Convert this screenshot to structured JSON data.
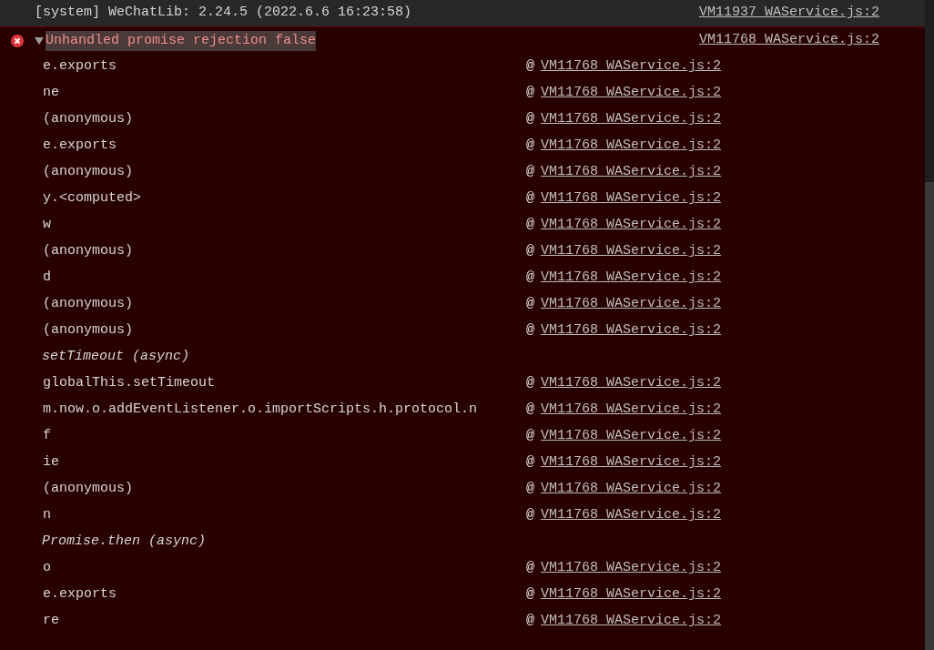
{
  "system_message": {
    "text": "[system] WeChatLib: 2.24.5 (2022.6.6 16:23:58)",
    "source": "VM11937 WAService.js:2"
  },
  "error": {
    "message": "Unhandled promise rejection false",
    "source": "VM11768 WAService.js:2",
    "expanded": true,
    "stack": [
      {
        "kind": "frame",
        "name": "e.exports",
        "at": "@",
        "source": "VM11768 WAService.js:2"
      },
      {
        "kind": "frame",
        "name": "ne",
        "at": "@",
        "source": "VM11768 WAService.js:2"
      },
      {
        "kind": "frame",
        "name": "(anonymous)",
        "at": "@",
        "source": "VM11768 WAService.js:2"
      },
      {
        "kind": "frame",
        "name": "e.exports",
        "at": "@",
        "source": "VM11768 WAService.js:2"
      },
      {
        "kind": "frame",
        "name": "(anonymous)",
        "at": "@",
        "source": "VM11768 WAService.js:2"
      },
      {
        "kind": "frame",
        "name": "y.<computed>",
        "at": "@",
        "source": "VM11768 WAService.js:2"
      },
      {
        "kind": "frame",
        "name": "w",
        "at": "@",
        "source": "VM11768 WAService.js:2"
      },
      {
        "kind": "frame",
        "name": "(anonymous)",
        "at": "@",
        "source": "VM11768 WAService.js:2"
      },
      {
        "kind": "frame",
        "name": "d",
        "at": "@",
        "source": "VM11768 WAService.js:2"
      },
      {
        "kind": "frame",
        "name": "(anonymous)",
        "at": "@",
        "source": "VM11768 WAService.js:2"
      },
      {
        "kind": "frame",
        "name": "(anonymous)",
        "at": "@",
        "source": "VM11768 WAService.js:2"
      },
      {
        "kind": "async",
        "name": "setTimeout (async)"
      },
      {
        "kind": "frame",
        "name": "globalThis.setTimeout",
        "at": "@",
        "source": "VM11768 WAService.js:2"
      },
      {
        "kind": "frame",
        "name": "m.now.o.addEventListener.o.importScripts.h.protocol.n",
        "at": "@",
        "source": "VM11768 WAService.js:2"
      },
      {
        "kind": "frame",
        "name": "f",
        "at": "@",
        "source": "VM11768 WAService.js:2"
      },
      {
        "kind": "frame",
        "name": "ie",
        "at": "@",
        "source": "VM11768 WAService.js:2"
      },
      {
        "kind": "frame",
        "name": "(anonymous)",
        "at": "@",
        "source": "VM11768 WAService.js:2"
      },
      {
        "kind": "frame",
        "name": "n",
        "at": "@",
        "source": "VM11768 WAService.js:2"
      },
      {
        "kind": "async",
        "name": "Promise.then (async)"
      },
      {
        "kind": "frame",
        "name": "o",
        "at": "@",
        "source": "VM11768 WAService.js:2"
      },
      {
        "kind": "frame",
        "name": "e.exports",
        "at": "@",
        "source": "VM11768 WAService.js:2"
      },
      {
        "kind": "frame",
        "name": "re",
        "at": "@",
        "source": "VM11768 WAService.js:2"
      }
    ]
  }
}
